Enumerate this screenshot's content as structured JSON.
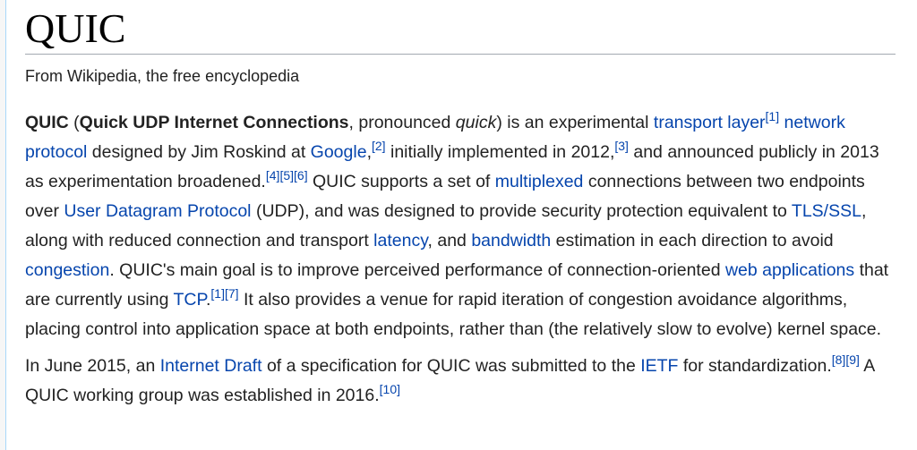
{
  "title": "QUIC",
  "tagline": "From Wikipedia, the free encyclopedia",
  "p1": {
    "term": "QUIC",
    "open_paren": " (",
    "expansion": "Quick UDP Internet Connections",
    "t1": ", pronounced ",
    "pron": "quick",
    "t2": ") is an experimental ",
    "link_transport_layer": "transport layer",
    "ref1": "[1]",
    "t3": " ",
    "link_network_protocol": "network protocol",
    "t4": " designed by Jim Roskind at ",
    "link_google": "Google",
    "t5": ",",
    "ref2": "[2]",
    "t6": " initially implemented in 2012,",
    "ref3": "[3]",
    "t7": " and announced publicly in 2013 as experimentation broadened.",
    "ref4": "[4]",
    "ref5": "[5]",
    "ref6": "[6]",
    "t8": " QUIC supports a set of ",
    "link_multiplexed": "multiplexed",
    "t9": " connections between two endpoints over ",
    "link_udp": "User Datagram Protocol",
    "t10": " (UDP), and was designed to provide security protection equivalent to ",
    "link_tls": "TLS/SSL",
    "t11": ", along with reduced connection and transport ",
    "link_latency": "latency",
    "t12": ", and ",
    "link_bandwidth": "bandwidth",
    "t13": " estimation in each direction to avoid ",
    "link_congestion": "congestion",
    "t14": ". QUIC's main goal is to improve perceived performance of connection-oriented ",
    "link_web_apps": "web applications",
    "t15": " that are currently using ",
    "link_tcp": "TCP",
    "t16": ".",
    "ref1b": "[1]",
    "ref7": "[7]",
    "t17": " It also provides a venue for rapid iteration of congestion avoidance algorithms, placing control into application space at both endpoints, rather than (the relatively slow to evolve) kernel space."
  },
  "p2": {
    "t1": "In June 2015, an ",
    "link_internet_draft": "Internet Draft",
    "t2": " of a specification for QUIC was submitted to the ",
    "link_ietf": "IETF",
    "t3": " for standardization.",
    "ref8": "[8]",
    "ref9": "[9]",
    "t4": " A QUIC working group was established in 2016.",
    "ref10": "[10]"
  }
}
